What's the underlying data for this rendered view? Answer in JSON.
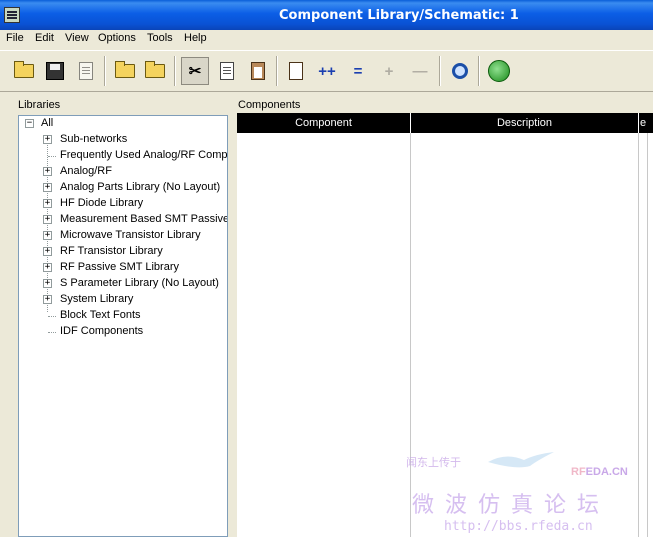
{
  "window": {
    "title": "Component Library/Schematic: 1"
  },
  "menu": [
    "File",
    "Edit",
    "View",
    "Options",
    "Tools",
    "Help"
  ],
  "toolbar": {
    "buttons": [
      {
        "icon": "open-folder-icon"
      },
      {
        "icon": "save-disk-icon"
      },
      {
        "icon": "delete-icon"
      },
      {
        "icon": "library-folder-icon"
      },
      {
        "icon": "library-folder-2-icon"
      },
      {
        "icon": "cut-icon"
      },
      {
        "icon": "copy-icon"
      },
      {
        "icon": "paste-icon"
      },
      {
        "icon": "refresh-icon"
      },
      {
        "icon": "add-icon"
      },
      {
        "icon": "equals-icon"
      },
      {
        "icon": "plus-disabled-icon"
      },
      {
        "icon": "minus-disabled-icon"
      },
      {
        "icon": "search-zoom-icon"
      },
      {
        "icon": "globe-icon"
      }
    ]
  },
  "libraries": {
    "label": "Libraries",
    "root": "All",
    "items": [
      {
        "label": "Sub-networks",
        "expandable": true
      },
      {
        "label": "Frequently Used Analog/RF Compo",
        "expandable": false
      },
      {
        "label": "Analog/RF",
        "expandable": true
      },
      {
        "label": "Analog Parts Library (No Layout)",
        "expandable": true
      },
      {
        "label": "HF Diode Library",
        "expandable": true
      },
      {
        "label": "Measurement Based SMT Passive",
        "expandable": true
      },
      {
        "label": "Microwave Transistor Library",
        "expandable": true
      },
      {
        "label": "RF Transistor Library",
        "expandable": true
      },
      {
        "label": "RF Passive SMT Library",
        "expandable": true
      },
      {
        "label": "S Parameter Library (No Layout)",
        "expandable": true
      },
      {
        "label": "System Library",
        "expandable": true
      },
      {
        "label": "Block Text Fonts",
        "expandable": false
      },
      {
        "label": "IDF Components",
        "expandable": false
      }
    ]
  },
  "components": {
    "label": "Components",
    "columns": [
      "Component",
      "Description",
      "e"
    ]
  },
  "watermark": {
    "top_text": "闻东上传于",
    "brand_prefix": "RF",
    "brand_suffix": "EDA.CN",
    "chinese": "微 波 仿 真 论 坛",
    "url": "http://bbs.rfeda.cn"
  },
  "colors": {
    "titlebar": "#0a5fd8",
    "header": "#000000",
    "panel": "#ece9d8",
    "watermark": "#c9a8e8"
  }
}
